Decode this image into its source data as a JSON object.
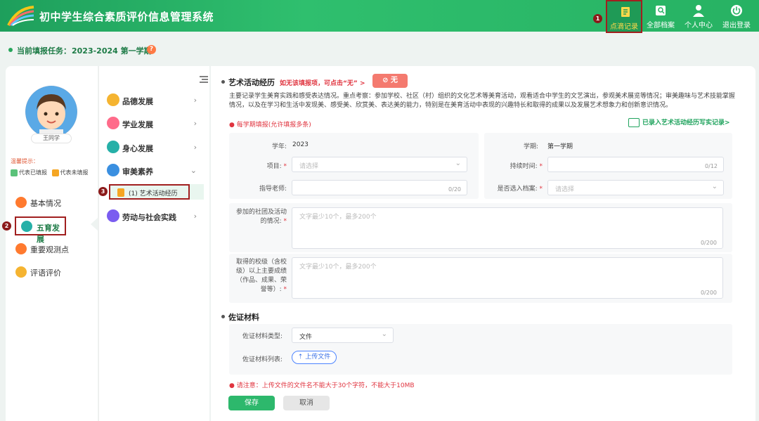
{
  "header": {
    "app_title": "初中学生综合素质评价信息管理系统",
    "nav": [
      {
        "label": "点滴记录",
        "icon": "note-record-icon",
        "marker": "1"
      },
      {
        "label": "全部档案",
        "icon": "archive-icon"
      },
      {
        "label": "个人中心",
        "icon": "user-icon"
      },
      {
        "label": "退出登录",
        "icon": "power-icon"
      }
    ]
  },
  "task": {
    "label": "当前填报任务：",
    "value": "2023-2024 第一学期"
  },
  "profile": {
    "name": "王同学",
    "hint_title": "温馨提示：",
    "legend_filled": "代表已填报",
    "legend_unfilled": "代表未填报"
  },
  "left_nav": [
    {
      "label": "基本情况",
      "icon": "basic-info-icon"
    },
    {
      "label": "五育发展",
      "icon": "five-education-icon",
      "marker": "2"
    },
    {
      "label": "重要观测点",
      "icon": "observation-icon"
    },
    {
      "label": "评语评价",
      "icon": "comment-icon"
    }
  ],
  "mid_nav": [
    {
      "label": "品德发展",
      "chev": "›"
    },
    {
      "label": "学业发展",
      "chev": "›"
    },
    {
      "label": "身心发展",
      "chev": "›"
    },
    {
      "label": "审美素养",
      "chev": "⌄"
    },
    {
      "label": "劳动与社会实践",
      "chev": "›"
    }
  ],
  "sub_nav": {
    "label": "(1) 艺术活动经历",
    "marker": "3"
  },
  "main": {
    "section_title": "艺术活动经历",
    "warn": "如无该填报项，可点击“无”  >",
    "none_label": "无",
    "description": "主要记录学生美育实践和感受表达情况。重点考察：参加学校、社区（村）组织的文化艺术等美育活动，观看适合中学生的文艺演出，参观美术展览等情况；审美趣味与艺术技能掌握情况，以及在学习和生活中发现美、感受美、欣赏美、表达美的能力，特别是在美育活动中表现的兴趣特长和取得的成果以及发展艺术想象力和创新意识情况。",
    "req_note": "每学期填报(允许填报多条)",
    "recorded_link": "已录入艺术活动经历写实记录>",
    "form": {
      "year_label": "学年:",
      "year_value": "2023",
      "term_label": "学期:",
      "term_value": "第一学期",
      "project_label": "项目:",
      "project_placeholder": "请选择",
      "duration_label": "持续时间:",
      "duration_count": "0/12",
      "teacher_label": "指导老师:",
      "teacher_count": "0/20",
      "archive_label": "是否选入档案:",
      "archive_placeholder": "请选择",
      "club_label": "参加的社团及活动的情况:",
      "club_placeholder": "文字最少10个，最多200个",
      "club_count": "0/200",
      "achieve_label": "取得的校级（含校级）以上主要成绩（作品、成果、荣誉等）:",
      "achieve_placeholder": "文字最少10个，最多200个",
      "achieve_count": "0/200"
    },
    "evidence": {
      "title": "佐证材料",
      "type_label": "佐证材料类型:",
      "type_value": "文件",
      "list_label": "佐证材料列表:",
      "upload_label": "上传文件"
    },
    "size_note": "请注意：上传文件的文件名不能大于30个字符，不能大于10MB",
    "save_label": "保存",
    "cancel_label": "取消"
  },
  "colors": {
    "brand": "#2db86c",
    "marker": "#8b1a1a",
    "warn": "#e0343f"
  }
}
